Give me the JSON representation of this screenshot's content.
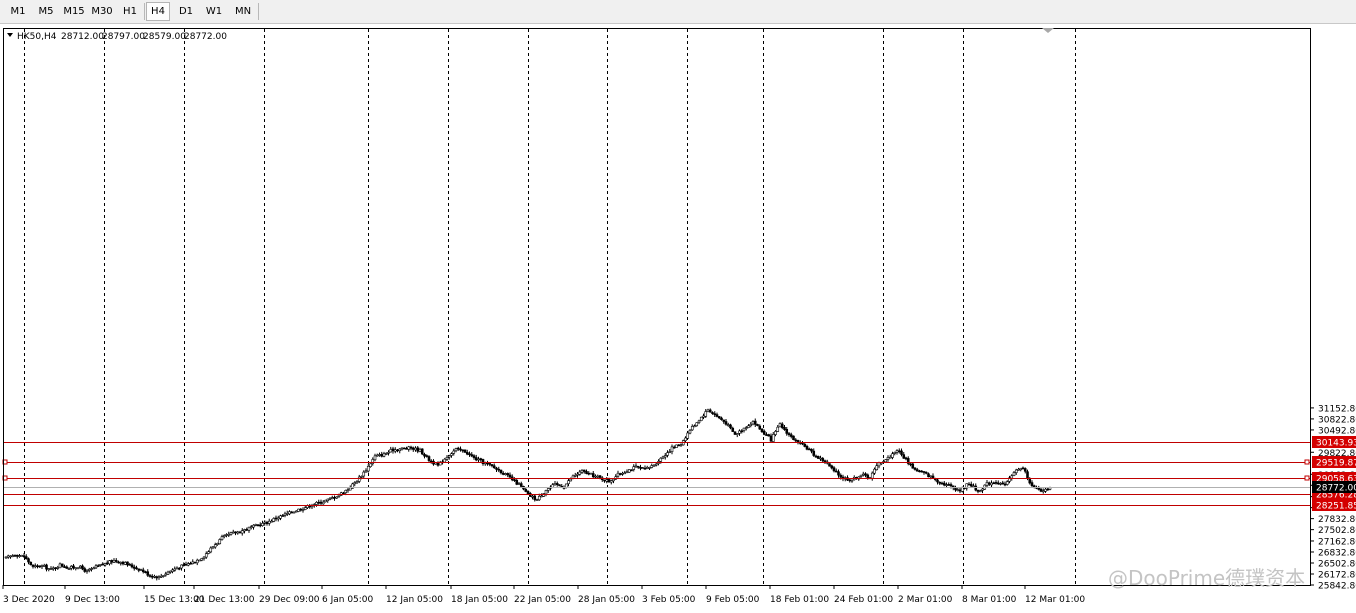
{
  "toolbar": {
    "timeframes": [
      "M1",
      "M5",
      "M15",
      "M30",
      "H1",
      "H4",
      "D1",
      "W1",
      "MN"
    ],
    "active": "H4"
  },
  "watermark": "@DooPrime德璞资本",
  "colors": {
    "level_line": "#c00000",
    "level_label_bg": "#d40000",
    "price_line": "#b0b0b0",
    "candle": "#000000",
    "background": "#ffffff"
  },
  "chart_data": {
    "type": "candlestick",
    "symbol_header": "HK50,H4",
    "header_values": [
      "28712.00",
      "28797.00",
      "28579.00",
      "28772.00"
    ],
    "y_range": [
      25842.8,
      31318.0
    ],
    "y_ticks": [
      "31152.80",
      "30822.80",
      "30492.80",
      "29822.80",
      "29162.80",
      "28832.80",
      "28492.80",
      "28162.80",
      "27832.80",
      "27502.80",
      "27162.80",
      "26832.80",
      "26502.80",
      "26172.80",
      "25842.80"
    ],
    "x_labels": [
      "3 Dec 2020",
      "9 Dec 13:00",
      "15 Dec 13:00",
      "21 Dec 13:00",
      "29 Dec 09:00",
      "6 Jan 05:00",
      "12 Jan 05:00",
      "18 Jan 05:00",
      "22 Jan 05:00",
      "28 Jan 05:00",
      "3 Feb 05:00",
      "9 Feb 05:00",
      "18 Feb 01:00",
      "24 Feb 01:00",
      "2 Mar 01:00",
      "8 Mar 01:00",
      "12 Mar 01:00"
    ],
    "horizontal_levels": [
      {
        "value": 30143.93,
        "label": "30143.93"
      },
      {
        "value": 29519.87,
        "label": "29519.87"
      },
      {
        "value": 29058.63,
        "label": "29058.63"
      },
      {
        "value": 28576.28,
        "label": "28576.28"
      },
      {
        "value": 28251.85,
        "label": "28251.85"
      }
    ],
    "current_price": {
      "value": 28772.0,
      "label": "28772.00"
    },
    "approx_close_path": [
      [
        0,
        26650
      ],
      [
        4,
        26760
      ],
      [
        8,
        26700
      ],
      [
        12,
        26380
      ],
      [
        16,
        26420
      ],
      [
        20,
        26300
      ],
      [
        24,
        26450
      ],
      [
        28,
        26350
      ],
      [
        32,
        26400
      ],
      [
        36,
        26250
      ],
      [
        40,
        26380
      ],
      [
        44,
        26480
      ],
      [
        48,
        26580
      ],
      [
        52,
        26520
      ],
      [
        56,
        26400
      ],
      [
        60,
        26300
      ],
      [
        64,
        26130
      ],
      [
        68,
        26080
      ],
      [
        72,
        26230
      ],
      [
        76,
        26360
      ],
      [
        80,
        26450
      ],
      [
        84,
        26550
      ],
      [
        88,
        26720
      ],
      [
        92,
        27000
      ],
      [
        96,
        27250
      ],
      [
        100,
        27380
      ],
      [
        104,
        27450
      ],
      [
        108,
        27550
      ],
      [
        112,
        27640
      ],
      [
        116,
        27720
      ],
      [
        120,
        27850
      ],
      [
        124,
        27950
      ],
      [
        128,
        28060
      ],
      [
        132,
        28150
      ],
      [
        136,
        28250
      ],
      [
        140,
        28330
      ],
      [
        144,
        28420
      ],
      [
        148,
        28550
      ],
      [
        152,
        28720
      ],
      [
        156,
        28980
      ],
      [
        160,
        29300
      ],
      [
        164,
        29700
      ],
      [
        168,
        29760
      ],
      [
        172,
        29900
      ],
      [
        176,
        29930
      ],
      [
        180,
        29950
      ],
      [
        184,
        29880
      ],
      [
        188,
        29600
      ],
      [
        192,
        29420
      ],
      [
        196,
        29700
      ],
      [
        200,
        29910
      ],
      [
        204,
        29850
      ],
      [
        208,
        29650
      ],
      [
        212,
        29520
      ],
      [
        216,
        29400
      ],
      [
        220,
        29250
      ],
      [
        224,
        29050
      ],
      [
        228,
        28850
      ],
      [
        232,
        28550
      ],
      [
        236,
        28400
      ],
      [
        240,
        28700
      ],
      [
        244,
        28850
      ],
      [
        248,
        28800
      ],
      [
        252,
        29100
      ],
      [
        256,
        29250
      ],
      [
        260,
        29150
      ],
      [
        264,
        29050
      ],
      [
        268,
        28950
      ],
      [
        272,
        29150
      ],
      [
        276,
        29280
      ],
      [
        280,
        29380
      ],
      [
        284,
        29300
      ],
      [
        288,
        29450
      ],
      [
        292,
        29700
      ],
      [
        296,
        29950
      ],
      [
        300,
        30080
      ],
      [
        304,
        30500
      ],
      [
        308,
        30800
      ],
      [
        312,
        31100
      ],
      [
        316,
        30900
      ],
      [
        320,
        30700
      ],
      [
        324,
        30350
      ],
      [
        328,
        30550
      ],
      [
        332,
        30750
      ],
      [
        336,
        30450
      ],
      [
        340,
        30200
      ],
      [
        344,
        30650
      ],
      [
        348,
        30350
      ],
      [
        352,
        30100
      ],
      [
        356,
        29950
      ],
      [
        360,
        29700
      ],
      [
        364,
        29550
      ],
      [
        368,
        29250
      ],
      [
        372,
        29050
      ],
      [
        376,
        29000
      ],
      [
        380,
        29150
      ],
      [
        384,
        29080
      ],
      [
        388,
        29500
      ],
      [
        392,
        29650
      ],
      [
        396,
        29900
      ],
      [
        400,
        29600
      ],
      [
        404,
        29300
      ],
      [
        408,
        29200
      ],
      [
        412,
        29050
      ],
      [
        416,
        28900
      ],
      [
        420,
        28800
      ],
      [
        424,
        28680
      ],
      [
        428,
        28900
      ],
      [
        432,
        28650
      ],
      [
        436,
        28880
      ],
      [
        440,
        28950
      ],
      [
        444,
        28820
      ],
      [
        448,
        29250
      ],
      [
        452,
        29350
      ],
      [
        456,
        28800
      ],
      [
        460,
        28650
      ],
      [
        464,
        28772
      ]
    ]
  }
}
